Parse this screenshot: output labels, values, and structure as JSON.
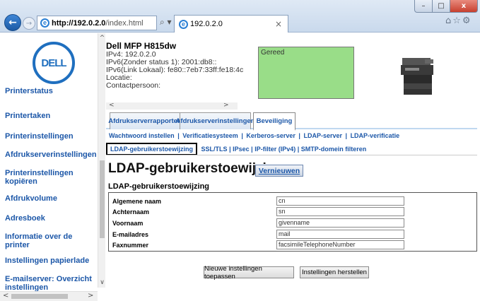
{
  "browser": {
    "url_host": "http://192.0.2.0",
    "url_path": "/index.html",
    "addr_tools": "⌕ ▾ ↻",
    "tab_title": "192.0.2.0",
    "tab_close": "×",
    "window_min": "–",
    "window_max": "□",
    "window_close": "x",
    "back": "←",
    "forward": "→",
    "right_icons": "⌂☆⚙"
  },
  "sidebar": {
    "logo_text": "DELL",
    "items": [
      {
        "label": "Printerstatus"
      },
      {
        "label": "Printertaken"
      },
      {
        "label": "Printerinstellingen"
      },
      {
        "label": "Afdrukserverinstellingen"
      },
      {
        "label": "Printerinstellingen kopiëren"
      },
      {
        "label": "Afdrukvolume"
      },
      {
        "label": "Adresboek"
      },
      {
        "label": "Informatie over de printer"
      },
      {
        "label": "Instellingen papierlade"
      },
      {
        "label": "E-mailserver: Overzicht instellingen"
      }
    ],
    "scroll_up": "^",
    "scroll_down": "∨",
    "scroll_left": "<",
    "scroll_right": ">"
  },
  "printer": {
    "name": "Dell MFP H815dw",
    "ipv4": "IPv4: 192.0.2.0",
    "ipv6_nostatus": "IPv6(Zonder status 1): 2001:db8::",
    "ipv6_link": "IPv6(Link Lokaal): fe80::7eb7:33ff:fe18:4c",
    "location": "Locatie:",
    "contact": "Contactpersoon:",
    "status": "Gereed",
    "status_color": "#99dd88",
    "scroll_left": "<",
    "scroll_right": ">"
  },
  "tabs": [
    {
      "label": "Afdrukserverrapporten",
      "active": false
    },
    {
      "label": "Afdrukserverinstellingen",
      "active": false
    },
    {
      "label": "Beveiliging",
      "active": true
    }
  ],
  "subnav": {
    "row1": [
      "Wachtwoord instellen",
      "Verificatiesysteem",
      "Kerberos-server",
      "LDAP-server",
      "LDAP-verificatie"
    ],
    "row2_active": "LDAP-gebruikerstoewijzing",
    "row2": [
      "SSL/TLS",
      "IPsec",
      "IP-filter (IPv4)",
      "SMTP-domein filteren"
    ],
    "separator": "|"
  },
  "page": {
    "title": "LDAP-gebruikerstoewijzing -",
    "refresh_label": "Vernieuwen",
    "section_title": "LDAP-gebruikerstoewijzing"
  },
  "form": {
    "fields": [
      {
        "label": "Algemene naam",
        "value": "cn"
      },
      {
        "label": "Achternaam",
        "value": "sn"
      },
      {
        "label": "Voornaam",
        "value": "givenname"
      },
      {
        "label": "E-mailadres",
        "value": "mail"
      },
      {
        "label": "Faxnummer",
        "value": "facsimileTelephoneNumber"
      }
    ]
  },
  "buttons": {
    "apply": "Nieuwe instellingen toepassen",
    "reset": "Instellingen herstellen"
  }
}
